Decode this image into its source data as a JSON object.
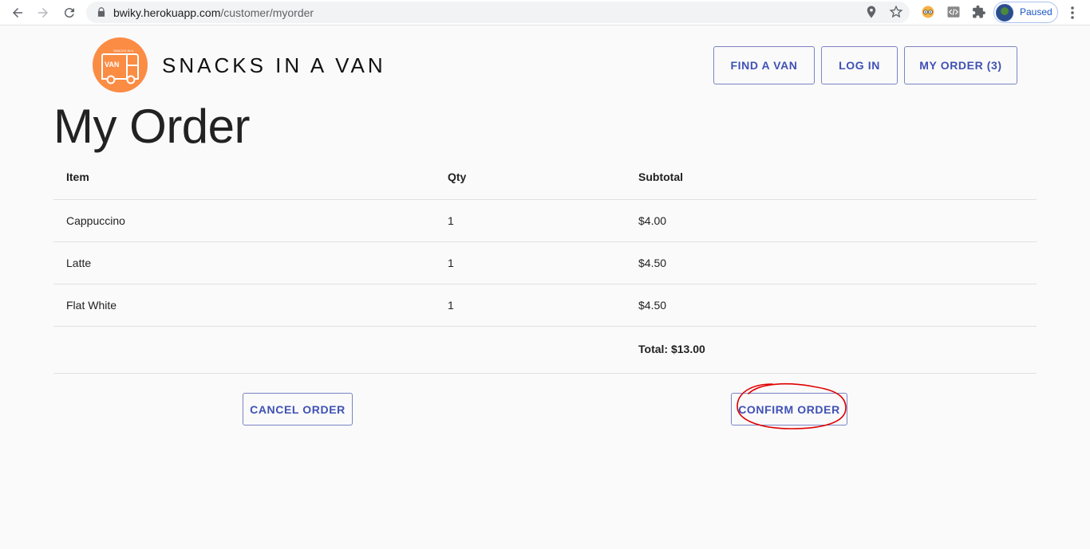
{
  "browser": {
    "url_host": "bwiky.herokuapp.com",
    "url_path": "/customer/myorder",
    "profile_status": "Paused"
  },
  "header": {
    "brand": "SNACKS IN A VAN",
    "logo_text": "VAN",
    "logo_small_text": "SNACKS IN A",
    "nav": {
      "find_van": "FIND A VAN",
      "log_in": "LOG IN",
      "my_order": "MY ORDER (3)"
    }
  },
  "page": {
    "title": "My Order"
  },
  "order_table": {
    "columns": [
      "Item",
      "Qty",
      "Subtotal"
    ],
    "rows": [
      {
        "item": "Cappuccino",
        "qty": "1",
        "subtotal": "$4.00"
      },
      {
        "item": "Latte",
        "qty": "1",
        "subtotal": "$4.50"
      },
      {
        "item": "Flat White",
        "qty": "1",
        "subtotal": "$4.50"
      }
    ],
    "total": "Total: $13.00"
  },
  "actions": {
    "cancel": "CANCEL ORDER",
    "confirm": "CONFIRM ORDER"
  },
  "colors": {
    "accent": "#3f51b5",
    "logo": "#fb8c44",
    "annotation": "#e00000"
  }
}
